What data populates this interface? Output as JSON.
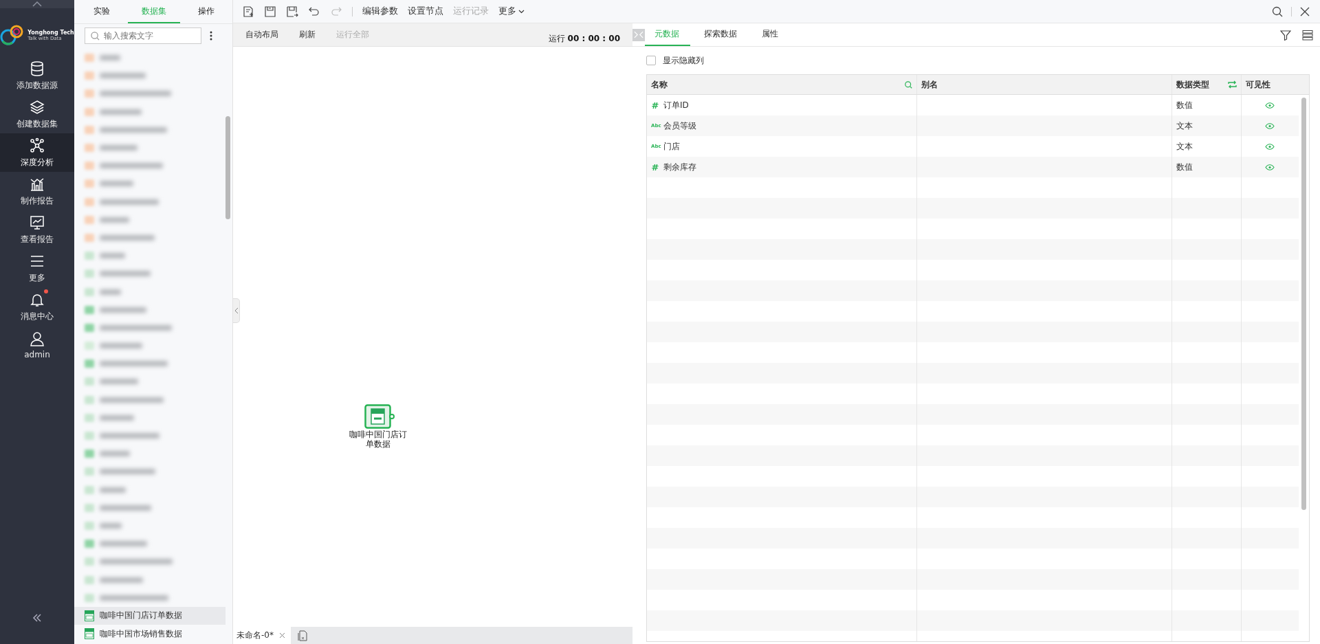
{
  "nav": {
    "logo": {
      "name": "Yonghong Tech",
      "slogan": "Talk with Data"
    },
    "items": [
      {
        "kind": "database",
        "label": "添加数据源",
        "selected": false,
        "notification": false
      },
      {
        "kind": "layers",
        "label": "创建数据集",
        "selected": false,
        "notification": false
      },
      {
        "kind": "network",
        "label": "深度分析",
        "selected": true,
        "notification": false
      },
      {
        "kind": "chart",
        "label": "制作报告",
        "selected": false,
        "notification": false
      },
      {
        "kind": "monitor",
        "label": "查看报告",
        "selected": false,
        "notification": false
      },
      {
        "kind": "menu",
        "label": "更多",
        "selected": false,
        "notification": false
      },
      {
        "kind": "bell",
        "label": "消息中心",
        "selected": false,
        "notification": true
      },
      {
        "kind": "user",
        "label": "admin",
        "selected": false,
        "notification": false
      }
    ]
  },
  "left_panel": {
    "tabs": [
      {
        "label": "实验",
        "selected": false
      },
      {
        "label": "数据集",
        "selected": true
      },
      {
        "label": "操作",
        "selected": false
      }
    ],
    "search": {
      "placeholder": "输入搜索文字"
    },
    "items": [
      {
        "kind": "folder",
        "blurred": true
      },
      {
        "kind": "folder",
        "blurred": true
      },
      {
        "kind": "folder",
        "blurred": true
      },
      {
        "kind": "folder",
        "blurred": true
      },
      {
        "kind": "folder",
        "blurred": true
      },
      {
        "kind": "folder",
        "blurred": true
      },
      {
        "kind": "folder",
        "blurred": true
      },
      {
        "kind": "folder",
        "blurred": true
      },
      {
        "kind": "folder",
        "blurred": true
      },
      {
        "kind": "folder",
        "blurred": true
      },
      {
        "kind": "folder",
        "blurred": true
      },
      {
        "kind": "sql",
        "blurred": true
      },
      {
        "kind": "sql",
        "blurred": true
      },
      {
        "kind": "sql",
        "blurred": true
      },
      {
        "kind": "dataset",
        "blurred": true
      },
      {
        "kind": "dataset",
        "blurred": true
      },
      {
        "kind": "model",
        "blurred": true
      },
      {
        "kind": "dataset",
        "blurred": true
      },
      {
        "kind": "sql",
        "blurred": true
      },
      {
        "kind": "sql",
        "blurred": true
      },
      {
        "kind": "sql",
        "blurred": true
      },
      {
        "kind": "sql",
        "blurred": true
      },
      {
        "kind": "dataset",
        "blurred": true
      },
      {
        "kind": "sql",
        "blurred": true
      },
      {
        "kind": "sql",
        "blurred": true
      },
      {
        "kind": "sql",
        "blurred": true
      },
      {
        "kind": "sql",
        "blurred": true
      },
      {
        "kind": "dataset",
        "blurred": true
      },
      {
        "kind": "sql",
        "blurred": true
      },
      {
        "kind": "sql",
        "blurred": true
      },
      {
        "kind": "sql",
        "blurred": true
      },
      {
        "kind": "sql",
        "blurred": false,
        "label": "咖啡中国门店订单数据",
        "selected": true
      },
      {
        "kind": "sql",
        "blurred": false,
        "label": "咖啡中国市场销售数据",
        "selected": false
      }
    ]
  },
  "toolbar": {
    "icons": [
      {
        "kind": "new",
        "disabled": false
      },
      {
        "kind": "save",
        "disabled": false
      },
      {
        "kind": "save-as",
        "disabled": false
      },
      {
        "kind": "undo",
        "disabled": false
      },
      {
        "kind": "redo",
        "disabled": true
      }
    ],
    "buttons": [
      {
        "label": "编辑参数",
        "disabled": false
      },
      {
        "label": "设置节点",
        "disabled": false
      },
      {
        "label": "运行记录",
        "disabled": true
      }
    ],
    "more": "更多"
  },
  "canvas_toolbar": {
    "buttons": [
      {
        "label": "自动布局",
        "disabled": false
      },
      {
        "label": "刷新",
        "disabled": false
      },
      {
        "label": "运行全部",
        "disabled": true
      }
    ],
    "run_label": "运行",
    "run_time": "00 : 00 : 00"
  },
  "canvas": {
    "node": {
      "label": "咖啡中国门店订单数据"
    }
  },
  "bottom_tabs": [
    {
      "label": "未命名-0*",
      "selected": true
    }
  ],
  "right_panel": {
    "tabs": [
      {
        "label": "元数据",
        "selected": true
      },
      {
        "label": "探索数据",
        "selected": false
      },
      {
        "label": "属性",
        "selected": false
      }
    ],
    "show_hidden": {
      "label": "显示隐藏列",
      "checked": false
    },
    "table": {
      "columns": [
        "名称",
        "别名",
        "数据类型",
        "可见性"
      ],
      "rows": [
        {
          "kind": "number",
          "type_mark": "#",
          "name": "订单ID",
          "type": "数值",
          "visible": true
        },
        {
          "kind": "text",
          "type_mark": "Abc",
          "name": "会员等级",
          "type": "文本",
          "visible": true
        },
        {
          "kind": "text",
          "type_mark": "Abc",
          "name": "门店",
          "type": "文本",
          "visible": true
        },
        {
          "kind": "number",
          "type_mark": "#",
          "name": "剩余库存",
          "type": "数值",
          "visible": true
        }
      ]
    }
  }
}
